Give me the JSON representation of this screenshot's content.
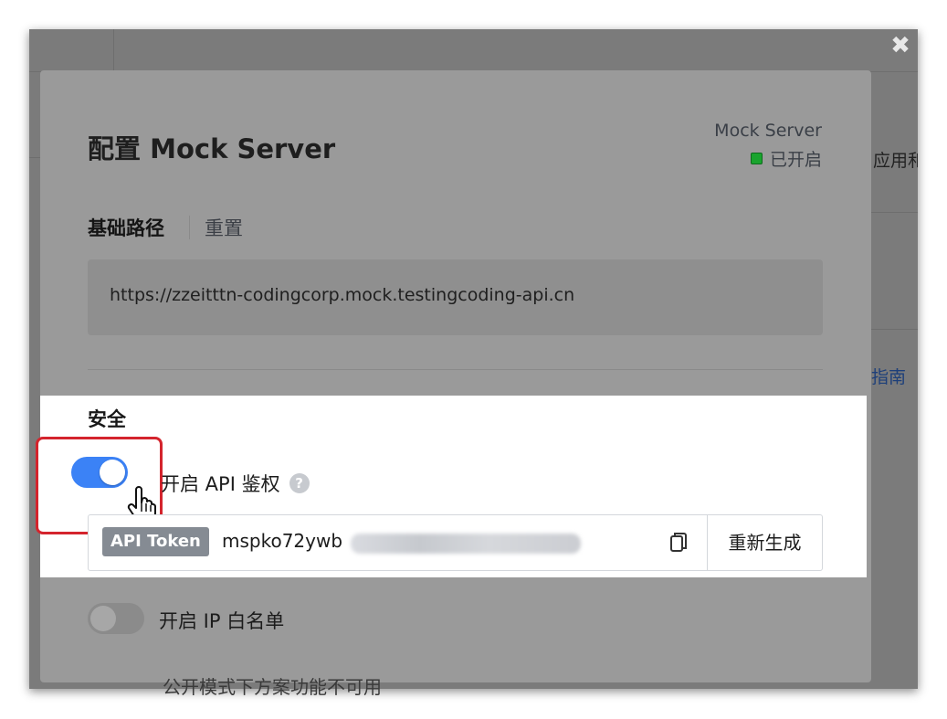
{
  "modal": {
    "title": "配置 Mock Server",
    "close_icon": "close-icon",
    "status": {
      "label": "Mock Server",
      "value": "已开启",
      "color": "#19a42e"
    },
    "base_path": {
      "label": "基础路径",
      "reset_label": "重置",
      "url": "https://zzeitttn-codingcorp.mock.testingcoding-api.cn"
    },
    "security": {
      "title": "安全",
      "api_auth": {
        "label": "开启 API 鉴权",
        "enabled": true,
        "help_icon": "help-icon"
      },
      "token": {
        "badge": "API Token",
        "value_prefix": "mspko72ywb",
        "regenerate_label": "重新生成",
        "copy_icon": "copy-icon"
      },
      "ip_whitelist": {
        "label": "开启 IP 白名单",
        "enabled": false
      }
    },
    "cutoff_text": "公开模式下方案功能不可用"
  },
  "background": {
    "side_text": "应用和",
    "side_link": "指南"
  },
  "colors": {
    "toggle_on": "#3b82f6",
    "highlight": "#d4242d"
  }
}
